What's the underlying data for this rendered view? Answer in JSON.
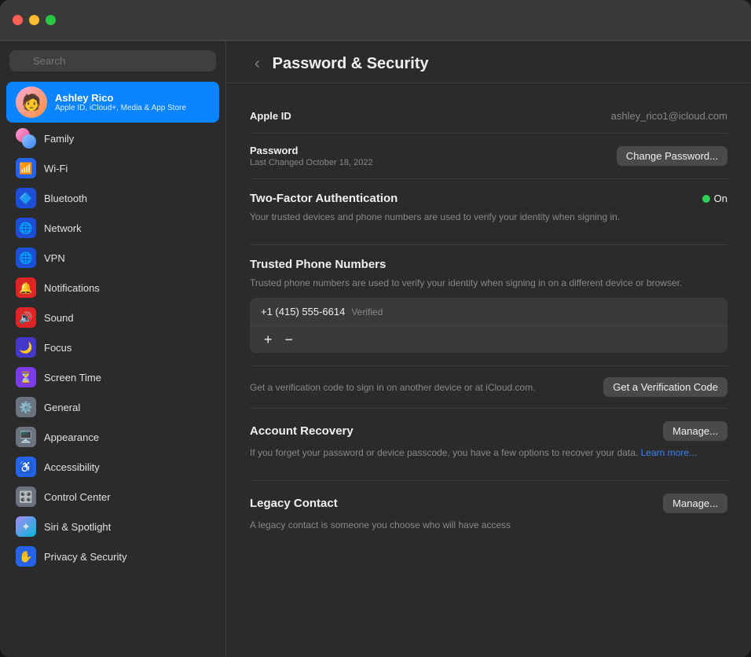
{
  "window": {
    "title": "Password & Security"
  },
  "sidebar": {
    "search_placeholder": "Search",
    "user": {
      "name": "Ashley Rico",
      "subtitle": "Apple ID, iCloud+, Media & App Store"
    },
    "items": [
      {
        "id": "family",
        "label": "Family",
        "icon": "family"
      },
      {
        "id": "wifi",
        "label": "Wi-Fi",
        "icon": "wifi"
      },
      {
        "id": "bluetooth",
        "label": "Bluetooth",
        "icon": "bluetooth"
      },
      {
        "id": "network",
        "label": "Network",
        "icon": "network"
      },
      {
        "id": "vpn",
        "label": "VPN",
        "icon": "vpn"
      },
      {
        "id": "notifications",
        "label": "Notifications",
        "icon": "notifications"
      },
      {
        "id": "sound",
        "label": "Sound",
        "icon": "sound"
      },
      {
        "id": "focus",
        "label": "Focus",
        "icon": "focus"
      },
      {
        "id": "screen-time",
        "label": "Screen Time",
        "icon": "screen-time"
      },
      {
        "id": "general",
        "label": "General",
        "icon": "general"
      },
      {
        "id": "appearance",
        "label": "Appearance",
        "icon": "appearance"
      },
      {
        "id": "accessibility",
        "label": "Accessibility",
        "icon": "accessibility"
      },
      {
        "id": "control-center",
        "label": "Control Center",
        "icon": "control-center"
      },
      {
        "id": "siri-spotlight",
        "label": "Siri & Spotlight",
        "icon": "siri"
      },
      {
        "id": "privacy-security",
        "label": "Privacy & Security",
        "icon": "privacy"
      }
    ]
  },
  "main": {
    "back_label": "‹",
    "title": "Password & Security",
    "apple_id_label": "Apple ID",
    "apple_id_value": "ashley_rico1@icloud.com",
    "password_label": "Password",
    "password_sublabel": "Last Changed October 18, 2022",
    "change_password_btn": "Change Password...",
    "two_factor": {
      "title": "Two-Factor Authentication",
      "desc": "Your trusted devices and phone numbers are used to verify your identity when signing in.",
      "status": "On"
    },
    "trusted_phone": {
      "title": "Trusted Phone Numbers",
      "desc": "Trusted phone numbers are used to verify your identity when signing in on a different device or browser.",
      "number": "+1 (415) 555-6614",
      "verified": "Verified",
      "add_btn": "+",
      "remove_btn": "−"
    },
    "verification": {
      "desc": "Get a verification code to sign in on another device or at iCloud.com.",
      "btn": "Get a Verification Code"
    },
    "account_recovery": {
      "title": "Account Recovery",
      "desc": "If you forget your password or device passcode, you have a few options to recover your data.",
      "learn_more": "Learn more...",
      "manage_btn": "Manage..."
    },
    "legacy_contact": {
      "title": "Legacy Contact",
      "desc": "A legacy contact is someone you choose who will have access",
      "manage_btn": "Manage..."
    }
  }
}
